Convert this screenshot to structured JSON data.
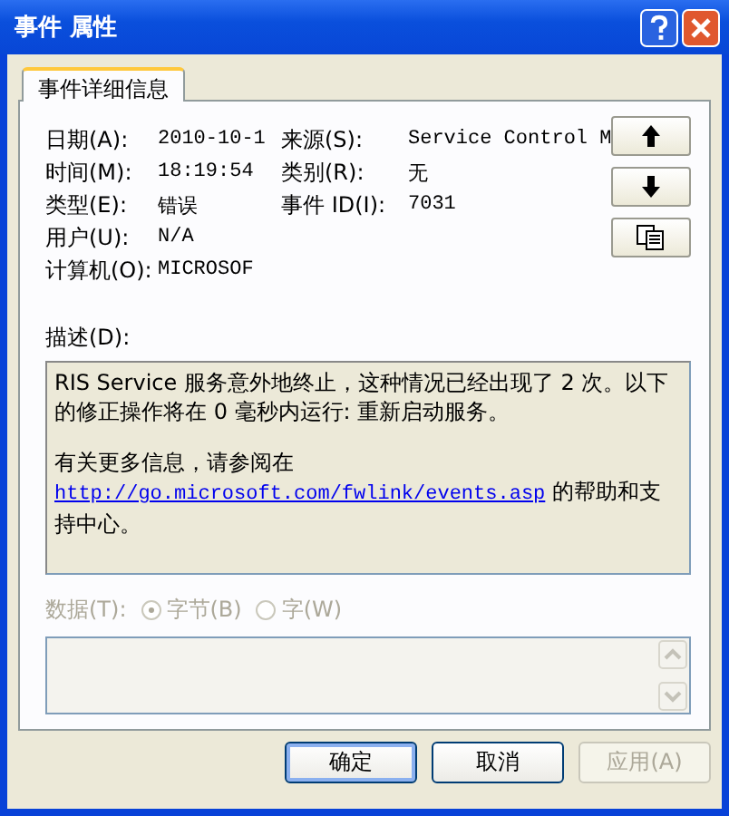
{
  "window": {
    "title": "事件 属性"
  },
  "tabs": [
    {
      "label": "事件详细信息",
      "selected": true
    }
  ],
  "fields": [
    [
      {
        "label": "日期(A):",
        "value": "2010-10-1"
      },
      {
        "label": "来源(S):",
        "value": "Service Control M"
      }
    ],
    [
      {
        "label": "时间(M):",
        "value": "18:19:54"
      },
      {
        "label": "类别(R):",
        "value": "无"
      }
    ],
    [
      {
        "label": "类型(E):",
        "value": "错误"
      },
      {
        "label": "事件 ID(I):",
        "value": "7031"
      }
    ],
    [
      {
        "label": "用户(U):",
        "value": "N/A"
      }
    ],
    [
      {
        "label": "计算机(O):",
        "value": "MICROSOF"
      }
    ]
  ],
  "nav_buttons": [
    {
      "kind": "up"
    },
    {
      "kind": "down"
    },
    {
      "kind": "copy"
    }
  ],
  "description": {
    "label": "描述(D):",
    "paragraphs": [
      {
        "text": "RIS Service 服务意外地终止，这种情况已经出现了 2 次。以下的修正操作将在 0 毫秒内运行: 重新启动服务。"
      },
      {
        "text": "有关更多信息，请参阅在",
        "link": "http://go.microsoft.com/fwlink/events.asp",
        "after": " 的帮助和支持中心。"
      }
    ]
  },
  "data": {
    "label": "数据(T):",
    "disabled": true,
    "options": [
      {
        "label": "字节(B)",
        "selected": true
      },
      {
        "label": "字(W)",
        "selected": false
      }
    ]
  },
  "buttons": [
    {
      "label": "确定",
      "disabled": false,
      "focused": true
    },
    {
      "label": "取消",
      "disabled": false,
      "focused": false
    },
    {
      "label": "应用(A)",
      "disabled": true,
      "focused": false
    }
  ]
}
